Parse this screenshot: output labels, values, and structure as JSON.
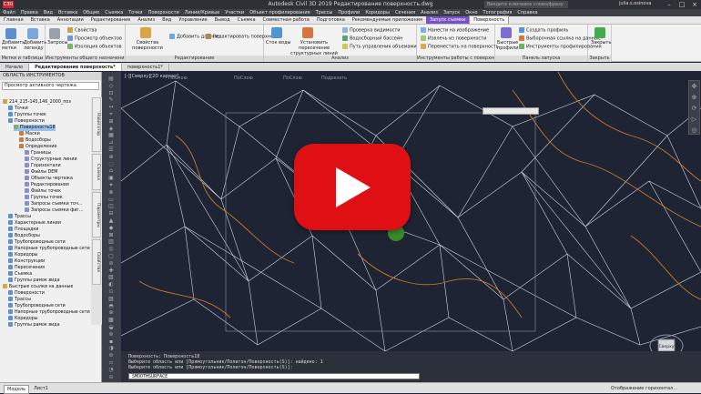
{
  "titlebar": {
    "logo": "C3D",
    "title": "Autodesk Civil 3D 2019   Редактирование поверхность.dwg",
    "search_placeholder": "Введите ключевое слово/фразу",
    "user": "julia.s.osinova"
  },
  "menubar": {
    "items": [
      "Файл",
      "Правка",
      "Вид",
      "Вставка",
      "Общие",
      "Съемка",
      "Точки",
      "Поверхности",
      "Линии/Кривые",
      "Участки",
      "Объект профилирования",
      "Трассы",
      "Профили",
      "Коридоры",
      "Сечения",
      "Анализ",
      "Запуск",
      "Окно",
      "Топография",
      "Справка"
    ]
  },
  "ribbon_tabs": {
    "items": [
      "Главная",
      "Вставка",
      "Аннотации",
      "Редактирование",
      "Анализ",
      "Вид",
      "Управление",
      "Вывод",
      "Съемка",
      "Совместная работа",
      "Подготовка",
      "Рекомендуемые приложения"
    ],
    "context": "Запуск съемки",
    "active": "Поверхность"
  },
  "ribbon": {
    "groups": [
      {
        "title": "Метки и таблицы",
        "buttons": [
          "Добавить метки",
          "Добавить легенду"
        ]
      },
      {
        "title": "Инструменты общего назначения",
        "buttons": [
          "Запросы",
          "Свойства",
          "Просмотр объектов",
          "Изоляция объектов"
        ]
      },
      {
        "title": "Редактирование",
        "buttons": [
          "Свойства поверхности",
          "Добавить данные",
          "Редактировать поверхность"
        ]
      },
      {
        "title": "Анализ",
        "buttons": [
          "Сток воды",
          "Установить пересечение структурных линий",
          "Проверка видимости",
          "Водосборный бассейн",
          "Путь управления объемами"
        ]
      },
      {
        "title": "Инструменты работы с поверхностью",
        "buttons": [
          "Нанести на изображение",
          "Извлечь из поверхности",
          "Переместить на поверхность"
        ]
      },
      {
        "title": "Панель запуска",
        "buttons": [
          "Быстрые профили",
          "Создать профиль",
          "Выборочная ссылка на данные",
          "Инструменты профилирования"
        ]
      },
      {
        "title": "Закрыть",
        "buttons": [
          "Закрыть"
        ]
      }
    ]
  },
  "doc_tabs": {
    "items": [
      "Начало",
      "Редактирование поверхность*",
      "поверхность1*"
    ]
  },
  "palette": {
    "title": "ОБЛАСТЬ ИНСТРУМЕНТОВ",
    "combo": "Просмотр активного чертежа",
    "tree": [
      {
        "label": "214_215-145,146_2000_поз",
        "depth": 0
      },
      {
        "label": "Точки",
        "depth": 1
      },
      {
        "label": "Группы точек",
        "depth": 1
      },
      {
        "label": "Поверхности",
        "depth": 1
      },
      {
        "label": "Поверхность18",
        "depth": 2,
        "sel": true
      },
      {
        "label": "Маски",
        "depth": 3
      },
      {
        "label": "Водосборы",
        "depth": 3
      },
      {
        "label": "Определение",
        "depth": 3
      },
      {
        "label": "Границы",
        "depth": 4
      },
      {
        "label": "Структурные линии",
        "depth": 4
      },
      {
        "label": "Горизонтали",
        "depth": 4
      },
      {
        "label": "Файлы DEM",
        "depth": 4
      },
      {
        "label": "Объекты чертежа",
        "depth": 4
      },
      {
        "label": "Редактирования",
        "depth": 4
      },
      {
        "label": "Файлы точек",
        "depth": 4
      },
      {
        "label": "Группы точек",
        "depth": 4
      },
      {
        "label": "Запросы съемки точ...",
        "depth": 4
      },
      {
        "label": "Запросы съемки фиг...",
        "depth": 4
      },
      {
        "label": "Трассы",
        "depth": 1
      },
      {
        "label": "Характерные линии",
        "depth": 1
      },
      {
        "label": "Площадки",
        "depth": 1
      },
      {
        "label": "Водосборы",
        "depth": 1
      },
      {
        "label": "Трубопроводные сети",
        "depth": 1
      },
      {
        "label": "Напорные трубопроводные сети",
        "depth": 1
      },
      {
        "label": "Коридоры",
        "depth": 1
      },
      {
        "label": "Конструкции",
        "depth": 1
      },
      {
        "label": "Пересечения",
        "depth": 1
      },
      {
        "label": "Съемка",
        "depth": 1
      },
      {
        "label": "Группы рамок вида",
        "depth": 1
      },
      {
        "label": "Быстрые ссылки на данные",
        "depth": 0
      },
      {
        "label": "Поверхности",
        "depth": 1
      },
      {
        "label": "Трассы",
        "depth": 1
      },
      {
        "label": "Трубопроводные сети",
        "depth": 1
      },
      {
        "label": "Напорные трубопроводные сети",
        "depth": 1
      },
      {
        "label": "Коридоры",
        "depth": 1
      },
      {
        "label": "Группы рамок вида",
        "depth": 1
      }
    ],
    "vtabs": [
      "Навигатор",
      "Съемка",
      "Параметры",
      "Свойства"
    ]
  },
  "canvas": {
    "viewport_label": "[-][Сверху][2D каркас]",
    "leader_labels": [
      "ПоСлою",
      "ПоСлою",
      "ПоСлою",
      "Подрезать"
    ]
  },
  "command": {
    "history": [
      "Поверхность: Поверхность18",
      "Выберите область или [Прямоугольник/Полигон/Поверхность(S)]: найдено: 1",
      "Выберите область или [Прямоугольник/Полигон/Поверхность(S)]:"
    ],
    "input": "SMOOTHSURFACE"
  },
  "status": {
    "tabs": [
      "Модель",
      "Лист1"
    ],
    "right": "Отображение горизонтал..."
  },
  "viewcube": {
    "label": "Сверху"
  },
  "colors": {
    "accent": "#7a52c7",
    "play": "#e00f14",
    "tin": "#c9d3df",
    "contour": "#c9782a"
  }
}
